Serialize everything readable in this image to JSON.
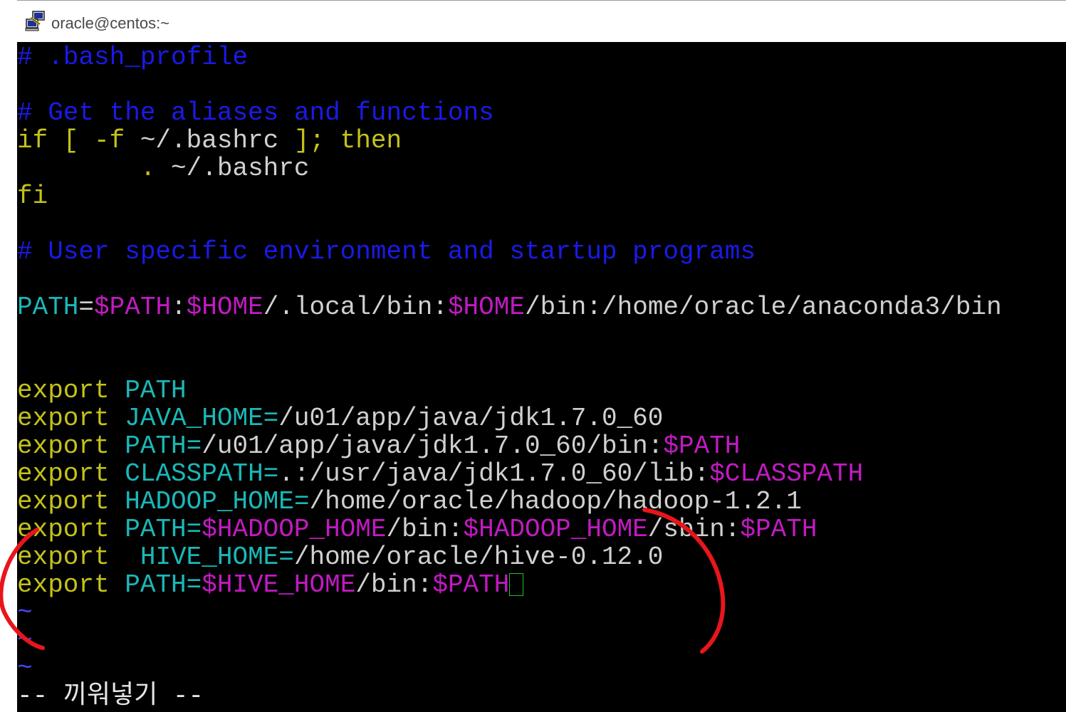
{
  "window": {
    "title": "oracle@centos:~",
    "icon": "putty-terminal-icon"
  },
  "colors": {
    "comment": "#1a1ae8",
    "keyword": "#c5c21a",
    "identifier": "#1ab8b8",
    "variable": "#c21ac2",
    "text": "#d0d0d0",
    "cursor": "#1fc21f",
    "annotation": "#e8161b"
  },
  "terminal": {
    "lines": [
      {
        "segments": [
          {
            "text": "# .bash_profile",
            "cls": "c-blue"
          }
        ]
      },
      {
        "segments": []
      },
      {
        "segments": [
          {
            "text": "# Get the aliases and functions",
            "cls": "c-blue"
          }
        ]
      },
      {
        "segments": [
          {
            "text": "if [ -f ",
            "cls": "c-yellow"
          },
          {
            "text": "~/.bashrc",
            "cls": "c-white"
          },
          {
            "text": " ]; then",
            "cls": "c-yellow"
          }
        ]
      },
      {
        "segments": [
          {
            "text": "        . ",
            "cls": "c-yellow"
          },
          {
            "text": "~/.bashrc",
            "cls": "c-white"
          }
        ]
      },
      {
        "segments": [
          {
            "text": "fi",
            "cls": "c-yellow"
          }
        ]
      },
      {
        "segments": []
      },
      {
        "segments": [
          {
            "text": "# User specific environment and startup programs",
            "cls": "c-blue"
          }
        ]
      },
      {
        "segments": []
      },
      {
        "segments": [
          {
            "text": "PATH",
            "cls": "c-cyan"
          },
          {
            "text": "=",
            "cls": "c-white"
          },
          {
            "text": "$PATH",
            "cls": "c-magenta"
          },
          {
            "text": ":",
            "cls": "c-white"
          },
          {
            "text": "$HOME",
            "cls": "c-magenta"
          },
          {
            "text": "/.local/bin:",
            "cls": "c-white"
          },
          {
            "text": "$HOME",
            "cls": "c-magenta"
          },
          {
            "text": "/bin:/home/oracle/anaconda3/bin",
            "cls": "c-white"
          }
        ]
      },
      {
        "segments": []
      },
      {
        "segments": []
      },
      {
        "segments": [
          {
            "text": "export ",
            "cls": "c-yellow"
          },
          {
            "text": "PATH",
            "cls": "c-cyan"
          }
        ]
      },
      {
        "segments": [
          {
            "text": "export ",
            "cls": "c-yellow"
          },
          {
            "text": "JAVA_HOME=",
            "cls": "c-cyan"
          },
          {
            "text": "/u01/app/java/jdk1.7.0_60",
            "cls": "c-white"
          }
        ]
      },
      {
        "segments": [
          {
            "text": "export ",
            "cls": "c-yellow"
          },
          {
            "text": "PATH=",
            "cls": "c-cyan"
          },
          {
            "text": "/u01/app/java/jdk1.7.0_60/bin:",
            "cls": "c-white"
          },
          {
            "text": "$PATH",
            "cls": "c-magenta"
          }
        ]
      },
      {
        "segments": [
          {
            "text": "export ",
            "cls": "c-yellow"
          },
          {
            "text": "CLASSPATH=",
            "cls": "c-cyan"
          },
          {
            "text": ".:/usr/java/jdk1.7.0_60/lib:",
            "cls": "c-white"
          },
          {
            "text": "$CLASSPATH",
            "cls": "c-magenta"
          }
        ]
      },
      {
        "segments": [
          {
            "text": "export ",
            "cls": "c-yellow"
          },
          {
            "text": "HADOOP_HOME=",
            "cls": "c-cyan"
          },
          {
            "text": "/home/oracle/hadoop/hadoop-1.2.1",
            "cls": "c-white"
          }
        ]
      },
      {
        "segments": [
          {
            "text": "export ",
            "cls": "c-yellow"
          },
          {
            "text": "PATH=",
            "cls": "c-cyan"
          },
          {
            "text": "$HADOOP_HOME",
            "cls": "c-magenta"
          },
          {
            "text": "/bin:",
            "cls": "c-white"
          },
          {
            "text": "$HADOOP_HOME",
            "cls": "c-magenta"
          },
          {
            "text": "/sbin:",
            "cls": "c-white"
          },
          {
            "text": "$PATH",
            "cls": "c-magenta"
          }
        ]
      },
      {
        "segments": [
          {
            "text": "export ",
            "cls": "c-yellow"
          },
          {
            "text": " HIVE_HOME=",
            "cls": "c-cyan"
          },
          {
            "text": "/home/oracle/hive-0.12.0",
            "cls": "c-white"
          }
        ]
      },
      {
        "segments": [
          {
            "text": "export ",
            "cls": "c-yellow"
          },
          {
            "text": "PATH=",
            "cls": "c-cyan"
          },
          {
            "text": "$HIVE_HOME",
            "cls": "c-magenta"
          },
          {
            "text": "/bin:",
            "cls": "c-white"
          },
          {
            "text": "$PATH",
            "cls": "c-magenta"
          }
        ],
        "cursor": true
      },
      {
        "segments": [
          {
            "text": "~",
            "cls": "c-tilde"
          }
        ]
      },
      {
        "segments": [
          {
            "text": "~",
            "cls": "c-tilde"
          }
        ]
      },
      {
        "segments": [
          {
            "text": "~",
            "cls": "c-tilde"
          }
        ]
      }
    ],
    "status_line": "-- 끼워넣기 --"
  }
}
